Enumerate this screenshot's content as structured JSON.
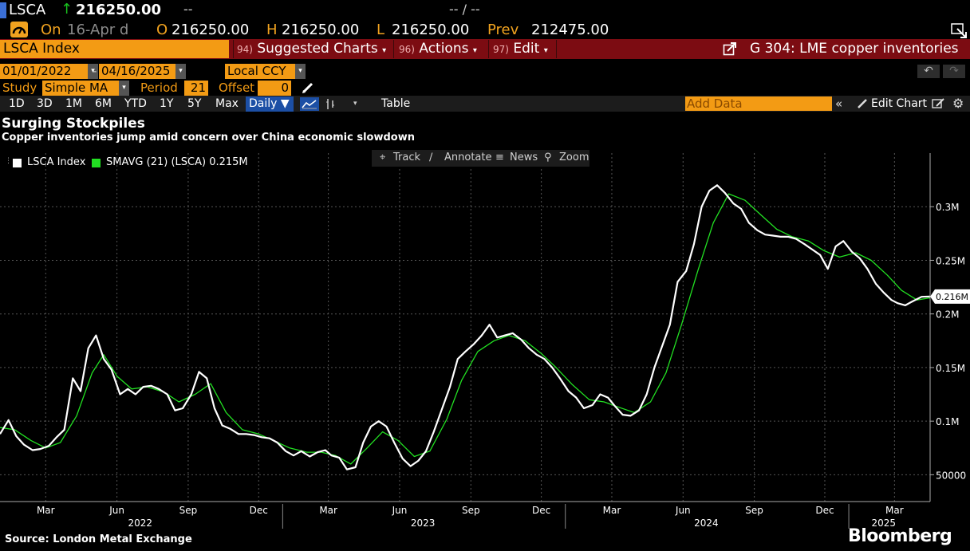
{
  "header": {
    "ticker": "LSCA",
    "last_price": "216250.00",
    "change_placeholder": "--",
    "change_pct_placeholder": "-- / --",
    "on_label": "On",
    "on_date": "16-Apr d",
    "open_label": "O",
    "open": "216250.00",
    "high_label": "H",
    "high": "216250.00",
    "low_label": "L",
    "low": "216250.00",
    "prev_label": "Prev",
    "prev": "212475.00"
  },
  "menubar": {
    "security": "LSCA Index",
    "suggested_num": "94)",
    "suggested": "Suggested Charts",
    "actions_num": "96)",
    "actions": "Actions",
    "edit_num": "97)",
    "edit": "Edit",
    "chart_title": "G 304: LME copper inventories"
  },
  "range": {
    "start": "01/01/2022",
    "sep": "-",
    "end": "04/16/2025",
    "currency": "Local CCY"
  },
  "study": {
    "label": "Study",
    "type": "Simple MA",
    "period_label": "Period",
    "period": "21",
    "offset_label": "Offset",
    "offset": "0"
  },
  "toolbar": {
    "periods": [
      "1D",
      "3D",
      "1M",
      "6M",
      "YTD",
      "1Y",
      "5Y",
      "Max"
    ],
    "frequency": "Daily",
    "table": "Table",
    "add_data_placeholder": "Add Data",
    "edit_chart": "Edit Chart"
  },
  "chart_tools": {
    "track": "Track",
    "annotate": "Annotate",
    "news": "News",
    "zoom": "Zoom"
  },
  "headline": "Surging Stockpiles",
  "subheadline": "Copper inventories jump amid concern over China economic slowdown",
  "legend": [
    {
      "label": "LSCA Index",
      "color": "#ffffff"
    },
    {
      "label": "SMAVG (21) (LSCA) 0.215M",
      "color": "#22e022"
    }
  ],
  "last_value_tag": "0.216M",
  "source": "Source: London Metal Exchange",
  "brand": "Bloomberg",
  "colors": {
    "accent_orange": "#f39b14",
    "menu_red": "#7c0c12",
    "up_green": "#19c21f",
    "series_main": "#ffffff",
    "series_ma": "#22e022"
  },
  "chart_data": {
    "type": "line",
    "title": "Surging Stockpiles",
    "subtitle": "Copper inventories jump amid concern over China economic slowdown",
    "xlim": [
      "2022-01-01",
      "2025-04-16"
    ],
    "ylim": [
      25000,
      350000
    ],
    "y_ticks": [
      50000,
      100000,
      150000,
      200000,
      250000,
      300000
    ],
    "y_tick_labels": [
      "50000",
      "0.1M",
      "0.15M",
      "0.2M",
      "0.25M",
      "0.3M"
    ],
    "x_tick_labels": [
      "Mar",
      "Jun",
      "Sep",
      "Dec",
      "Mar",
      "Jun",
      "Sep",
      "Dec",
      "Mar",
      "Jun",
      "Sep",
      "Dec",
      "Mar"
    ],
    "x_tick_dates": [
      "2022-03-01",
      "2022-06-01",
      "2022-09-01",
      "2022-12-01",
      "2023-03-01",
      "2023-06-01",
      "2023-09-01",
      "2023-12-01",
      "2024-03-01",
      "2024-06-01",
      "2024-09-01",
      "2024-12-01",
      "2025-03-01"
    ],
    "year_labels": [
      {
        "label": "2022",
        "date": "2022-07-01"
      },
      {
        "label": "2023",
        "date": "2023-07-01"
      },
      {
        "label": "2024",
        "date": "2024-07-01"
      },
      {
        "label": "2025",
        "date": "2025-02-15"
      }
    ],
    "year_dividers": [
      "2023-01-01",
      "2024-01-01",
      "2025-01-01"
    ],
    "grid": true,
    "legend_position": "top-left",
    "series": [
      {
        "name": "LSCA Index",
        "color": "#ffffff",
        "points": [
          [
            "2022-01-01",
            88000
          ],
          [
            "2022-01-12",
            101000
          ],
          [
            "2022-01-22",
            86000
          ],
          [
            "2022-02-01",
            78000
          ],
          [
            "2022-02-12",
            73000
          ],
          [
            "2022-02-22",
            74000
          ],
          [
            "2022-03-05",
            77000
          ],
          [
            "2022-03-15",
            85000
          ],
          [
            "2022-03-25",
            92000
          ],
          [
            "2022-04-05",
            140000
          ],
          [
            "2022-04-15",
            128000
          ],
          [
            "2022-04-25",
            168000
          ],
          [
            "2022-05-05",
            180000
          ],
          [
            "2022-05-15",
            158000
          ],
          [
            "2022-05-25",
            148000
          ],
          [
            "2022-06-05",
            125000
          ],
          [
            "2022-06-15",
            130000
          ],
          [
            "2022-06-25",
            125000
          ],
          [
            "2022-07-05",
            132000
          ],
          [
            "2022-07-15",
            133000
          ],
          [
            "2022-07-25",
            130000
          ],
          [
            "2022-08-05",
            125000
          ],
          [
            "2022-08-15",
            110000
          ],
          [
            "2022-08-25",
            112000
          ],
          [
            "2022-09-05",
            125000
          ],
          [
            "2022-09-15",
            146000
          ],
          [
            "2022-09-25",
            140000
          ],
          [
            "2022-10-05",
            112000
          ],
          [
            "2022-10-15",
            96000
          ],
          [
            "2022-10-25",
            93000
          ],
          [
            "2022-11-05",
            88000
          ],
          [
            "2022-11-15",
            88000
          ],
          [
            "2022-11-25",
            87000
          ],
          [
            "2022-12-05",
            85000
          ],
          [
            "2022-12-15",
            84000
          ],
          [
            "2022-12-25",
            80000
          ],
          [
            "2023-01-05",
            72000
          ],
          [
            "2023-01-15",
            68000
          ],
          [
            "2023-01-25",
            72000
          ],
          [
            "2023-02-05",
            67000
          ],
          [
            "2023-02-15",
            71000
          ],
          [
            "2023-02-25",
            73000
          ],
          [
            "2023-03-05",
            68000
          ],
          [
            "2023-03-15",
            66000
          ],
          [
            "2023-03-25",
            55000
          ],
          [
            "2023-04-05",
            57000
          ],
          [
            "2023-04-15",
            80000
          ],
          [
            "2023-04-25",
            95000
          ],
          [
            "2023-05-05",
            100000
          ],
          [
            "2023-05-15",
            95000
          ],
          [
            "2023-05-25",
            80000
          ],
          [
            "2023-06-05",
            65000
          ],
          [
            "2023-06-15",
            58000
          ],
          [
            "2023-06-25",
            63000
          ],
          [
            "2023-07-05",
            72000
          ],
          [
            "2023-07-15",
            90000
          ],
          [
            "2023-07-25",
            110000
          ],
          [
            "2023-08-05",
            132000
          ],
          [
            "2023-08-15",
            158000
          ],
          [
            "2023-08-25",
            165000
          ],
          [
            "2023-09-05",
            172000
          ],
          [
            "2023-09-15",
            180000
          ],
          [
            "2023-09-25",
            190000
          ],
          [
            "2023-10-05",
            178000
          ],
          [
            "2023-10-15",
            180000
          ],
          [
            "2023-10-25",
            182000
          ],
          [
            "2023-11-05",
            176000
          ],
          [
            "2023-11-15",
            168000
          ],
          [
            "2023-11-25",
            162000
          ],
          [
            "2023-12-05",
            158000
          ],
          [
            "2023-12-15",
            150000
          ],
          [
            "2023-12-25",
            140000
          ],
          [
            "2024-01-05",
            128000
          ],
          [
            "2024-01-15",
            122000
          ],
          [
            "2024-01-25",
            112000
          ],
          [
            "2024-02-05",
            115000
          ],
          [
            "2024-02-15",
            125000
          ],
          [
            "2024-02-25",
            122000
          ],
          [
            "2024-03-05",
            114000
          ],
          [
            "2024-03-15",
            106000
          ],
          [
            "2024-03-25",
            105000
          ],
          [
            "2024-04-05",
            110000
          ],
          [
            "2024-04-15",
            125000
          ],
          [
            "2024-04-25",
            150000
          ],
          [
            "2024-05-05",
            170000
          ],
          [
            "2024-05-15",
            190000
          ],
          [
            "2024-05-25",
            230000
          ],
          [
            "2024-06-05",
            240000
          ],
          [
            "2024-06-15",
            265000
          ],
          [
            "2024-06-25",
            300000
          ],
          [
            "2024-07-05",
            315000
          ],
          [
            "2024-07-15",
            320000
          ],
          [
            "2024-07-25",
            313000
          ],
          [
            "2024-08-05",
            303000
          ],
          [
            "2024-08-15",
            298000
          ],
          [
            "2024-08-25",
            285000
          ],
          [
            "2024-09-05",
            278000
          ],
          [
            "2024-09-15",
            274000
          ],
          [
            "2024-09-25",
            273000
          ],
          [
            "2024-10-05",
            272000
          ],
          [
            "2024-10-15",
            272000
          ],
          [
            "2024-10-25",
            270000
          ],
          [
            "2024-11-05",
            265000
          ],
          [
            "2024-11-15",
            260000
          ],
          [
            "2024-11-25",
            255000
          ],
          [
            "2024-12-05",
            242000
          ],
          [
            "2024-12-15",
            263000
          ],
          [
            "2024-12-25",
            268000
          ],
          [
            "2025-01-05",
            258000
          ],
          [
            "2025-01-15",
            252000
          ],
          [
            "2025-01-25",
            242000
          ],
          [
            "2025-02-05",
            228000
          ],
          [
            "2025-02-15",
            220000
          ],
          [
            "2025-02-25",
            213000
          ],
          [
            "2025-03-05",
            210000
          ],
          [
            "2025-03-15",
            208000
          ],
          [
            "2025-03-25",
            212000
          ],
          [
            "2025-04-05",
            216000
          ],
          [
            "2025-04-16",
            216250
          ]
        ]
      },
      {
        "name": "SMAVG (21) (LSCA) 0.215M",
        "color": "#22e022",
        "points": [
          [
            "2022-01-01",
            94000
          ],
          [
            "2022-01-20",
            92000
          ],
          [
            "2022-02-10",
            82000
          ],
          [
            "2022-03-01",
            75000
          ],
          [
            "2022-03-20",
            80000
          ],
          [
            "2022-04-10",
            105000
          ],
          [
            "2022-04-30",
            145000
          ],
          [
            "2022-05-15",
            162000
          ],
          [
            "2022-06-01",
            142000
          ],
          [
            "2022-06-20",
            130000
          ],
          [
            "2022-07-10",
            132000
          ],
          [
            "2022-08-01",
            127000
          ],
          [
            "2022-08-20",
            118000
          ],
          [
            "2022-09-10",
            125000
          ],
          [
            "2022-09-30",
            135000
          ],
          [
            "2022-10-20",
            108000
          ],
          [
            "2022-11-10",
            92000
          ],
          [
            "2022-12-01",
            88000
          ],
          [
            "2022-12-20",
            82000
          ],
          [
            "2023-01-10",
            75000
          ],
          [
            "2023-02-01",
            71000
          ],
          [
            "2023-02-20",
            71000
          ],
          [
            "2023-03-10",
            68000
          ],
          [
            "2023-03-30",
            60000
          ],
          [
            "2023-04-20",
            75000
          ],
          [
            "2023-05-10",
            90000
          ],
          [
            "2023-05-30",
            82000
          ],
          [
            "2023-06-20",
            67000
          ],
          [
            "2023-07-10",
            72000
          ],
          [
            "2023-08-01",
            102000
          ],
          [
            "2023-08-20",
            138000
          ],
          [
            "2023-09-10",
            165000
          ],
          [
            "2023-10-01",
            175000
          ],
          [
            "2023-10-20",
            180000
          ],
          [
            "2023-11-10",
            175000
          ],
          [
            "2023-12-01",
            163000
          ],
          [
            "2023-12-20",
            150000
          ],
          [
            "2024-01-10",
            134000
          ],
          [
            "2024-02-01",
            120000
          ],
          [
            "2024-02-20",
            118000
          ],
          [
            "2024-03-10",
            113000
          ],
          [
            "2024-03-30",
            108000
          ],
          [
            "2024-04-20",
            118000
          ],
          [
            "2024-05-10",
            145000
          ],
          [
            "2024-05-30",
            190000
          ],
          [
            "2024-06-20",
            240000
          ],
          [
            "2024-07-10",
            285000
          ],
          [
            "2024-07-30",
            312000
          ],
          [
            "2024-08-20",
            306000
          ],
          [
            "2024-09-10",
            292000
          ],
          [
            "2024-09-30",
            279000
          ],
          [
            "2024-10-20",
            272000
          ],
          [
            "2024-11-10",
            268000
          ],
          [
            "2024-11-30",
            259000
          ],
          [
            "2024-12-20",
            253000
          ],
          [
            "2025-01-10",
            257000
          ],
          [
            "2025-01-30",
            250000
          ],
          [
            "2025-02-20",
            236000
          ],
          [
            "2025-03-10",
            222000
          ],
          [
            "2025-03-30",
            213000
          ],
          [
            "2025-04-16",
            215000
          ]
        ]
      }
    ]
  }
}
